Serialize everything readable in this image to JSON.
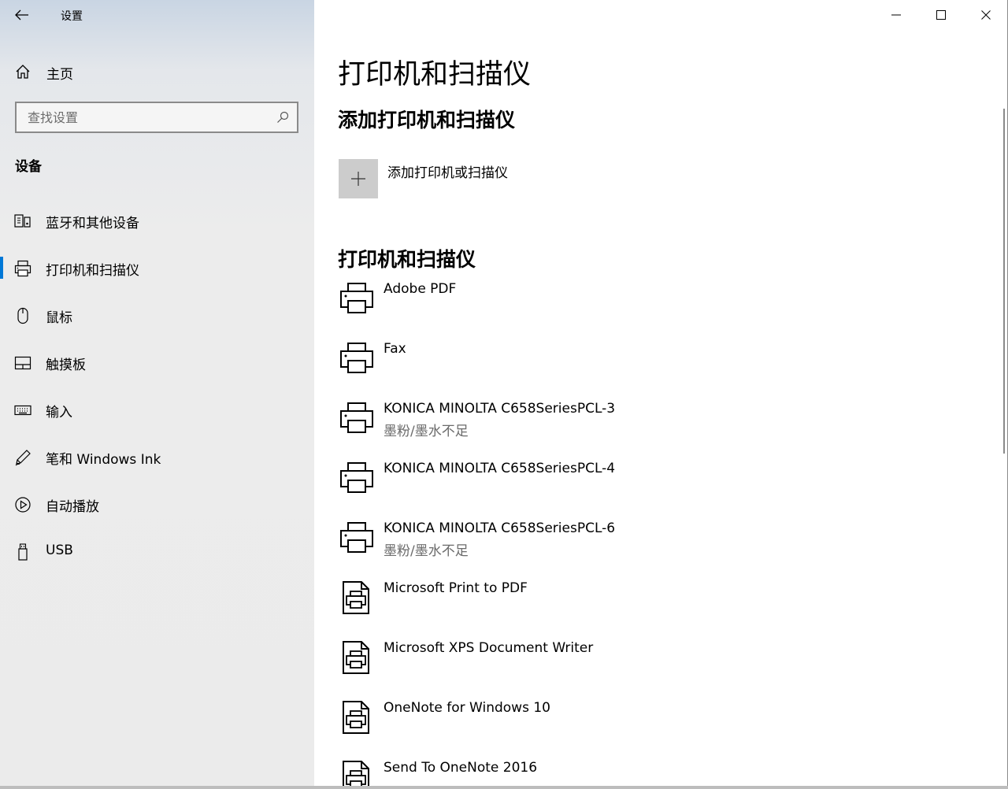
{
  "window": {
    "title": "设置"
  },
  "sidebar": {
    "home_label": "主页",
    "search_placeholder": "查找设置",
    "section_heading": "设备",
    "items": [
      {
        "label": "蓝牙和其他设备",
        "icon": "bluetooth-devices-icon",
        "active": false
      },
      {
        "label": "打印机和扫描仪",
        "icon": "printer-icon",
        "active": true
      },
      {
        "label": "鼠标",
        "icon": "mouse-icon",
        "active": false
      },
      {
        "label": "触摸板",
        "icon": "touchpad-icon",
        "active": false
      },
      {
        "label": "输入",
        "icon": "keyboard-icon",
        "active": false
      },
      {
        "label": "笔和 Windows Ink",
        "icon": "pen-icon",
        "active": false
      },
      {
        "label": "自动播放",
        "icon": "autoplay-icon",
        "active": false
      },
      {
        "label": "USB",
        "icon": "usb-icon",
        "active": false
      }
    ]
  },
  "main": {
    "page_title": "打印机和扫描仪",
    "add_section_title": "添加打印机和扫描仪",
    "add_button_label": "添加打印机或扫描仪",
    "list_section_title": "打印机和扫描仪",
    "printers": [
      {
        "name": "Adobe PDF",
        "status": "",
        "icon": "printer"
      },
      {
        "name": "Fax",
        "status": "",
        "icon": "printer"
      },
      {
        "name": "KONICA MINOLTA C658SeriesPCL-3",
        "status": "墨粉/墨水不足",
        "icon": "printer"
      },
      {
        "name": "KONICA MINOLTA C658SeriesPCL-4",
        "status": "",
        "icon": "printer"
      },
      {
        "name": "KONICA MINOLTA C658SeriesPCL-6",
        "status": "墨粉/墨水不足",
        "icon": "printer"
      },
      {
        "name": "Microsoft Print to PDF",
        "status": "",
        "icon": "document-printer"
      },
      {
        "name": "Microsoft XPS Document Writer",
        "status": "",
        "icon": "document-printer"
      },
      {
        "name": "OneNote for Windows 10",
        "status": "",
        "icon": "document-printer"
      },
      {
        "name": "Send To OneNote 2016",
        "status": "",
        "icon": "document-printer"
      }
    ]
  },
  "colors": {
    "accent": "#0078d7",
    "sidebar_bg": "#ebebeb",
    "status_text": "#6b6b6b",
    "add_tile": "#cccccc"
  }
}
